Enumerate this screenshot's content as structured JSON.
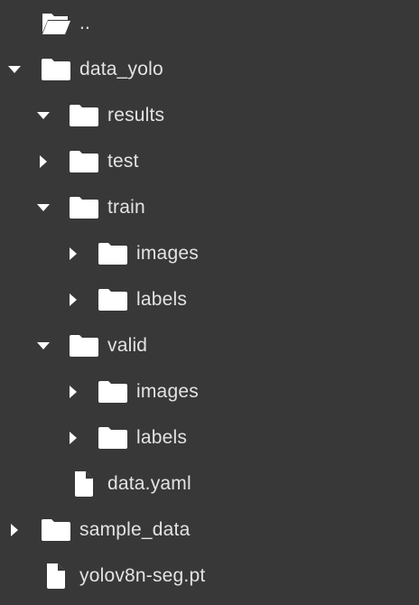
{
  "file_tree": {
    "items": [
      {
        "label": "..",
        "icon": "folder-open-icon",
        "depth": 0,
        "caret": "none"
      },
      {
        "label": "data_yolo",
        "icon": "folder-icon",
        "depth": 0,
        "caret": "down"
      },
      {
        "label": "results",
        "icon": "folder-icon",
        "depth": 1,
        "caret": "down"
      },
      {
        "label": "test",
        "icon": "folder-icon",
        "depth": 1,
        "caret": "right"
      },
      {
        "label": "train",
        "icon": "folder-icon",
        "depth": 1,
        "caret": "down"
      },
      {
        "label": "images",
        "icon": "folder-icon",
        "depth": 2,
        "caret": "right"
      },
      {
        "label": "labels",
        "icon": "folder-icon",
        "depth": 2,
        "caret": "right"
      },
      {
        "label": "valid",
        "icon": "folder-icon",
        "depth": 1,
        "caret": "down"
      },
      {
        "label": "images",
        "icon": "folder-icon",
        "depth": 2,
        "caret": "right"
      },
      {
        "label": "labels",
        "icon": "folder-icon",
        "depth": 2,
        "caret": "right"
      },
      {
        "label": "data.yaml",
        "icon": "file-icon",
        "depth": 1,
        "caret": "none"
      },
      {
        "label": "sample_data",
        "icon": "folder-icon",
        "depth": 0,
        "caret": "right"
      },
      {
        "label": "yolov8n-seg.pt",
        "icon": "file-icon",
        "depth": 0,
        "caret": "none"
      }
    ]
  },
  "colors": {
    "background": "#383838",
    "text": "#e3e3e3",
    "icon": "#ffffff"
  }
}
